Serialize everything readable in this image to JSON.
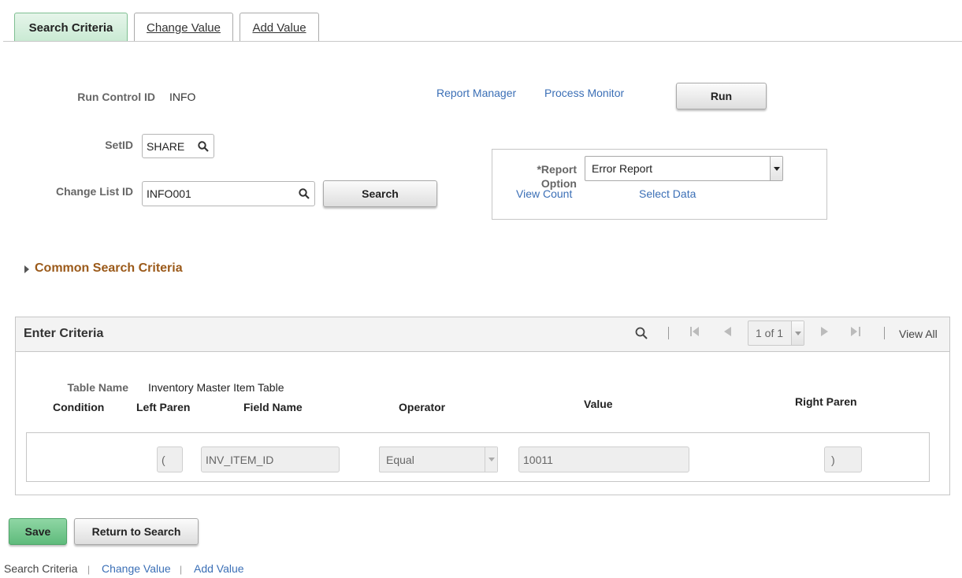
{
  "tabs": [
    "Search Criteria",
    "Change Value",
    "Add Value"
  ],
  "run_control": {
    "label": "Run Control ID",
    "value": "INFO"
  },
  "links": {
    "report_manager": "Report Manager",
    "process_monitor": "Process Monitor"
  },
  "run_button": "Run",
  "setid": {
    "label": "SetID",
    "value": "SHARE"
  },
  "change_list": {
    "label": "Change List ID",
    "value": "INFO001"
  },
  "search_button": "Search",
  "report_option": {
    "label_line1": "*Report",
    "label_line2": "Option",
    "selected": "Error Report",
    "view_count": "View Count",
    "select_data": "Select Data"
  },
  "common_search": "Common Search Criteria",
  "grid": {
    "title": "Enter Criteria",
    "pager": "1 of 1",
    "view_all": "View All",
    "table_name_label": "Table Name",
    "table_name_value": "Inventory Master Item Table",
    "headers": {
      "condition": "Condition",
      "left_paren": "Left Paren",
      "field_name": "Field Name",
      "operator": "Operator",
      "value": "Value",
      "right_paren": "Right Paren"
    },
    "row": {
      "left_paren": "(",
      "field_name": "INV_ITEM_ID",
      "operator": "Equal",
      "value": "10011",
      "right_paren": ")"
    }
  },
  "bottom_buttons": {
    "save": "Save",
    "return": "Return to Search"
  },
  "footer_links": [
    "Search Criteria",
    "Change Value",
    "Add Value"
  ],
  "colors": {
    "link": "#3b6fb6",
    "accent_green": "#5fbb7c",
    "section_orange": "#9b5a1a"
  }
}
